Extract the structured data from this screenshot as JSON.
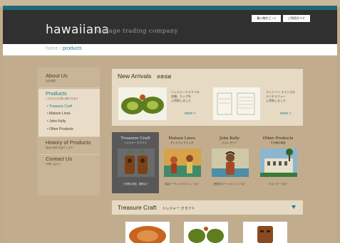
{
  "header": {
    "logo": "hawaiiana",
    "tagline": "vintage trading company",
    "buttons": [
      "買い物かご・0",
      "ご利用ガイド"
    ]
  },
  "breadcrumb": {
    "home": "home",
    "separator": "›",
    "current": "products"
  },
  "sidebar": {
    "sections": [
      {
        "title": "About Us",
        "subtitle": "会社概要"
      },
      {
        "title": "Products",
        "subtitle": "こちらからお買い物できます",
        "items": [
          "Treasure Craft",
          "Matson Lines",
          "John Kelly",
          "Other Products"
        ]
      },
      {
        "title": "History of Products",
        "subtitle": "商品の歴史を紹介します"
      },
      {
        "title": "Contact Us",
        "subtitle": "お問い合わせ"
      }
    ]
  },
  "new_arrivals": {
    "title": "New Arrivals",
    "title_jp": "新着情報",
    "items": [
      {
        "desc": [
          "トレジャークラフトの",
          "皿類、カップを",
          "入荷致しました"
        ],
        "more": "more >"
      },
      {
        "desc": [
          "マットソン ラインズの",
          "ランチメニュー",
          "入荷致しました"
        ],
        "more": "more >"
      }
    ]
  },
  "categories": [
    {
      "title": "Treasure Craft",
      "title_jp": "トレジャー クラフト",
      "caption": "ビ系陶の灰皿、置物など"
    },
    {
      "title": "Matson Lines",
      "title_jp": "マットソン ラインズ",
      "caption": "船会アーティストのメニューなど"
    },
    {
      "title": "John Kelly",
      "title_jp": "ジョン ケリー",
      "caption": "歴史的なアートのメニューなど"
    },
    {
      "title": "Other Products",
      "title_jp": "その他の商品",
      "caption": "ポストカードなど"
    }
  ],
  "treasure": {
    "title": "Treasure Craft",
    "title_jp": "トレジャー クラフト"
  },
  "colors": {
    "teal": "#1f6878",
    "header": "#303030",
    "background": "#bfaa8b",
    "panel": "#e6dac4",
    "link": "#1f7a8c"
  }
}
